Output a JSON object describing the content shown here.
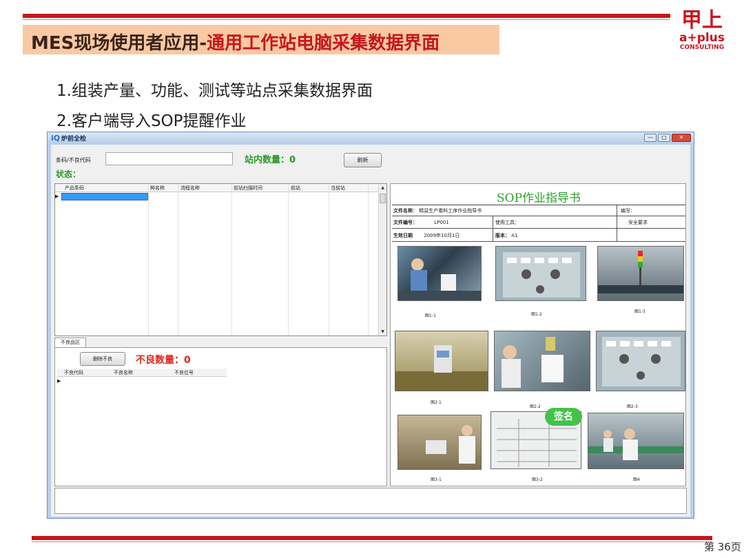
{
  "slide": {
    "title_prefix": "MES现场使用者应用-",
    "title_main": "通用工作站电脑采集数据界面",
    "bullets": [
      "1.组装产量、功能、测试等站点采集数据界面",
      "2.客户端导入SOP提醒作业"
    ],
    "page": "第 36页"
  },
  "logo": {
    "line1": "甲上",
    "line2": "a+plus",
    "line3": "CONSULTING"
  },
  "window": {
    "title": "炉前全检",
    "icon": "app-icon",
    "controls": {
      "min": "—",
      "max": "□",
      "close": "✕"
    }
  },
  "form": {
    "barcode_label": "条码/不良代码",
    "barcode_value": "",
    "station_count_label": "站内数量：",
    "station_count_value": "0",
    "refresh_label": "刷新",
    "status_label": "状态："
  },
  "main_grid": {
    "columns": [
      "产品条码",
      "种名称",
      "流程名称",
      "前站扫描时间",
      "前站",
      "当前站"
    ],
    "row_marker": "▶"
  },
  "defect_tab": {
    "tab_label": "不良品区",
    "delete_button": "删除不良",
    "bad_count_label": "不良数量：",
    "bad_count_value": "0",
    "columns": [
      "不良代码",
      "不良名称",
      "不良位号"
    ],
    "row_marker": "▶"
  },
  "sop": {
    "title": "SOP作业指导书",
    "file_name_label": "文件名称：",
    "file_name_value": "精益生产看料工序作业指导书",
    "file_no_label": "文件编号：",
    "file_no_value": "LP001",
    "effective_date_label": "生效日期",
    "effective_date_value": "2009年10月1日",
    "tools_label": "使用工具：",
    "version_label": "版本：",
    "version_value": "A1",
    "editor_label": "编写：",
    "safety_label": "安全要求",
    "captions": [
      "图1-1",
      "图1-2",
      "图1-3",
      "图2-1",
      "图2-2",
      "图2-3",
      "图3-1",
      "图3-2",
      "图4"
    ],
    "sign_label": "签名"
  },
  "colors": {
    "brand_red": "#c8161d",
    "status_green": "#2a9a2a",
    "alert_red": "#e0261b",
    "selection_blue": "#3399ff"
  }
}
